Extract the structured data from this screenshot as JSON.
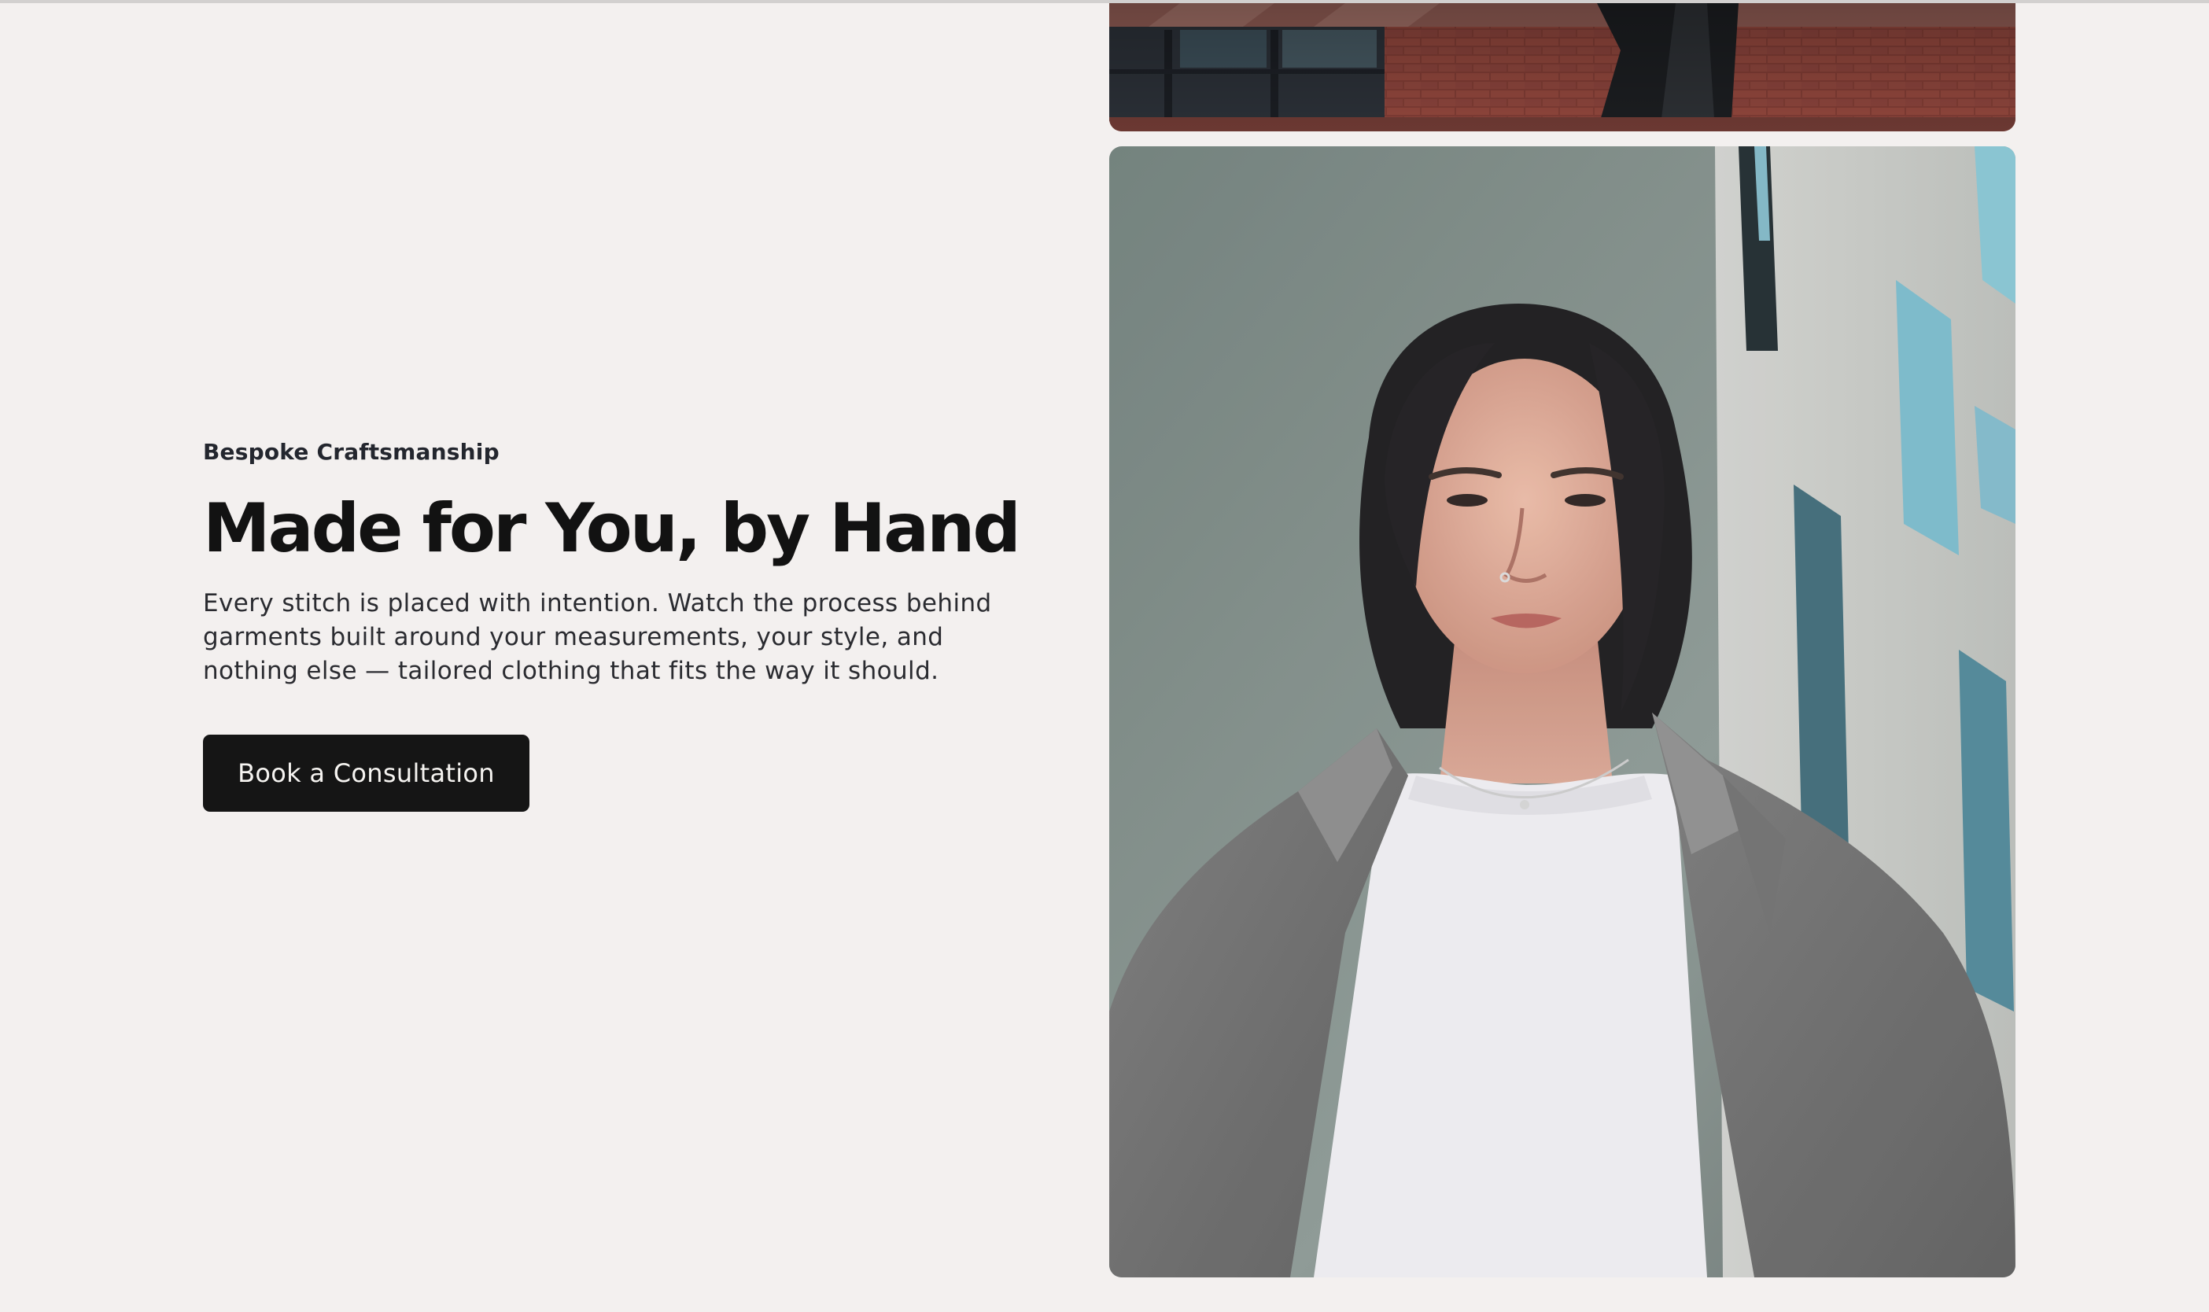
{
  "hero": {
    "eyebrow": "Bespoke Craftsmanship",
    "title": "Made for You, by Hand",
    "description": "Every stitch is placed with intention. Watch the process behind garments built around your measurements, your style, and nothing else — tailored clothing that fits the way it should.",
    "cta_label": "Book a Consultation"
  },
  "colors": {
    "page_background": "#f3f0ef",
    "button_background": "#151515",
    "button_text": "#f6f4f1",
    "heading_text": "#121212"
  },
  "media": {
    "top_image": "building-detail-photo",
    "main_image": "portrait-photo"
  }
}
